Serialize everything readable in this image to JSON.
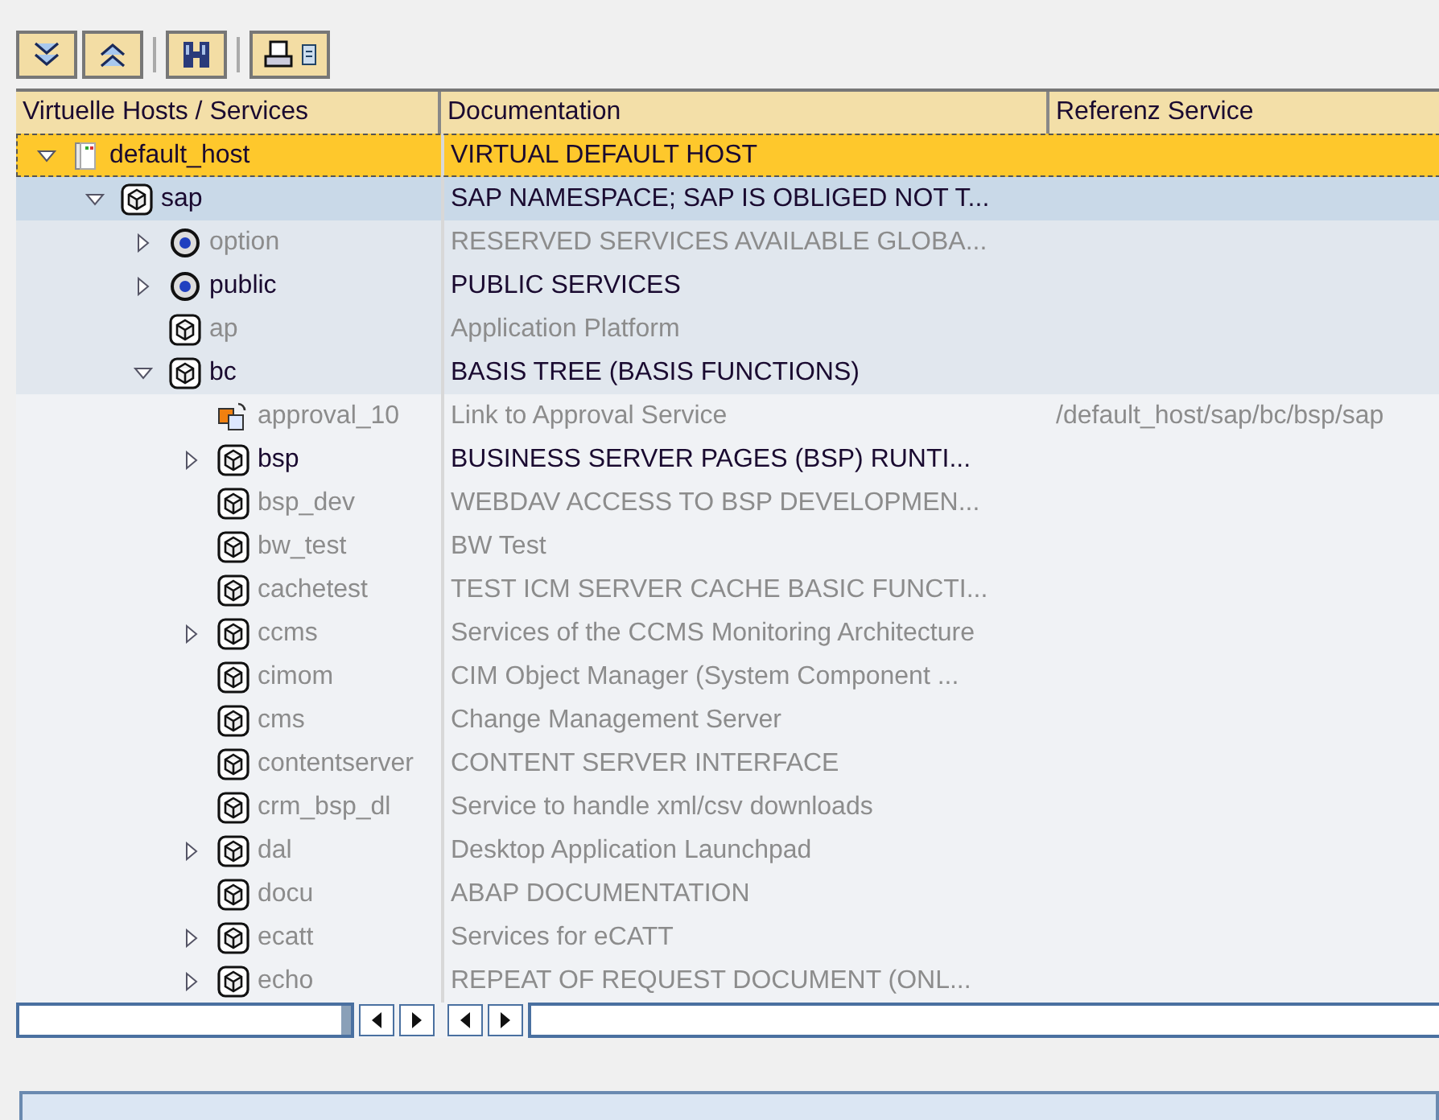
{
  "toolbar": [
    {
      "kind": "expand-all"
    },
    {
      "kind": "collapse-all"
    },
    {
      "kind": "separator"
    },
    {
      "kind": "find"
    },
    {
      "kind": "separator"
    },
    {
      "kind": "print"
    }
  ],
  "columns": [
    "Virtuelle Hosts / Services",
    "Documentation",
    "Referenz Service"
  ],
  "tree": [
    {
      "name": "default_host",
      "documentation": "VIRTUAL DEFAULT HOST",
      "kind": "host",
      "active": true,
      "selected": true,
      "expanded": true,
      "children": [
        {
          "name": "sap",
          "documentation": "SAP NAMESPACE; SAP IS OBLIGED NOT T...",
          "kind": "service",
          "active": true,
          "selected": false,
          "expanded": true,
          "children": [
            {
              "name": "option",
              "documentation": "RESERVED SERVICES AVAILABLE GLOBA...",
              "kind": "eye",
              "active": false,
              "selected": false,
              "expanded": false
            },
            {
              "name": "public",
              "documentation": "PUBLIC SERVICES",
              "kind": "eye",
              "active": true,
              "selected": false,
              "expanded": false
            },
            {
              "name": "ap",
              "documentation": "Application Platform",
              "kind": "service",
              "active": false,
              "selected": false
            },
            {
              "name": "bc",
              "documentation": "BASIS TREE (BASIS FUNCTIONS)",
              "kind": "service",
              "active": true,
              "selected": false,
              "expanded": true,
              "children": [
                {
                  "name": "approval_10",
                  "documentation": "Link to Approval Service",
                  "reference": "/default_host/sap/bc/bsp/sap",
                  "kind": "link",
                  "active": false,
                  "selected": false
                },
                {
                  "name": "bsp",
                  "documentation": "BUSINESS SERVER PAGES (BSP) RUNTI...",
                  "kind": "service",
                  "active": true,
                  "selected": false,
                  "expanded": false
                },
                {
                  "name": "bsp_dev",
                  "documentation": "WEBDAV ACCESS TO BSP DEVELOPMEN...",
                  "kind": "service",
                  "active": false,
                  "selected": false
                },
                {
                  "name": "bw_test",
                  "documentation": "BW Test",
                  "kind": "service",
                  "active": false,
                  "selected": false
                },
                {
                  "name": "cachetest",
                  "documentation": "TEST ICM SERVER CACHE BASIC FUNCTI...",
                  "kind": "service",
                  "active": false,
                  "selected": false
                },
                {
                  "name": "ccms",
                  "documentation": "Services of the CCMS Monitoring Architecture",
                  "kind": "service",
                  "active": false,
                  "selected": false,
                  "expanded": false
                },
                {
                  "name": "cimom",
                  "documentation": "CIM Object Manager (System Component ...",
                  "kind": "service",
                  "active": false,
                  "selected": false
                },
                {
                  "name": "cms",
                  "documentation": "Change Management Server",
                  "kind": "service",
                  "active": false,
                  "selected": false
                },
                {
                  "name": "contentserver",
                  "documentation": "CONTENT SERVER INTERFACE",
                  "kind": "service",
                  "active": false,
                  "selected": false
                },
                {
                  "name": "crm_bsp_dl",
                  "documentation": "Service to handle xml/csv downloads",
                  "kind": "service",
                  "active": false,
                  "selected": false
                },
                {
                  "name": "dal",
                  "documentation": "Desktop Application Launchpad",
                  "kind": "service",
                  "active": false,
                  "selected": false,
                  "expanded": false
                },
                {
                  "name": "docu",
                  "documentation": "ABAP DOCUMENTATION",
                  "kind": "service",
                  "active": false,
                  "selected": false
                },
                {
                  "name": "ecatt",
                  "documentation": "Services for eCATT",
                  "kind": "service",
                  "active": false,
                  "selected": false,
                  "expanded": false
                },
                {
                  "name": "echo",
                  "documentation": "REPEAT OF REQUEST DOCUMENT (ONL...",
                  "kind": "service",
                  "active": false,
                  "selected": false,
                  "expanded": false
                }
              ]
            }
          ]
        }
      ]
    }
  ]
}
